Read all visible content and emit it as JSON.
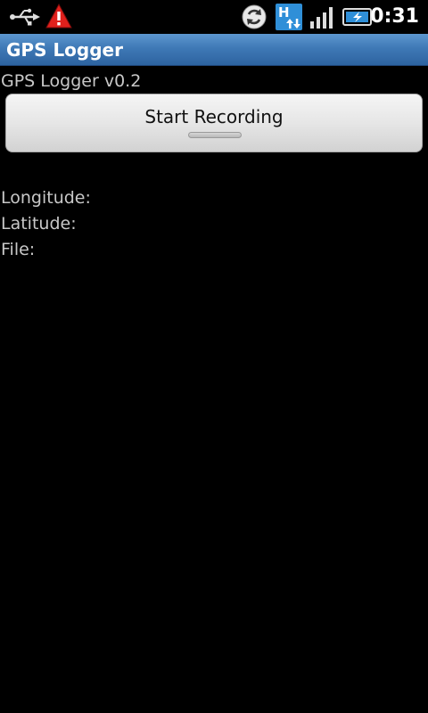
{
  "status_bar": {
    "time": "0:31",
    "icons": [
      "usb-icon",
      "warning-icon",
      "sync-icon",
      "hsdpa-icon",
      "signal-icon",
      "battery-charging-icon"
    ],
    "hsdpa_badge": "H"
  },
  "app": {
    "title": "GPS Logger",
    "version_text": "GPS Logger v0.2",
    "record_button_label": "Start Recording",
    "labels": {
      "longitude": "Longitude:",
      "latitude": "Latitude:",
      "file": "File:"
    }
  },
  "colors": {
    "title_bar": "#3f79b6",
    "background": "#000000",
    "text": "#c8c8c8",
    "warning": "#e0201c",
    "hsdpa": "#2f8fd8"
  }
}
